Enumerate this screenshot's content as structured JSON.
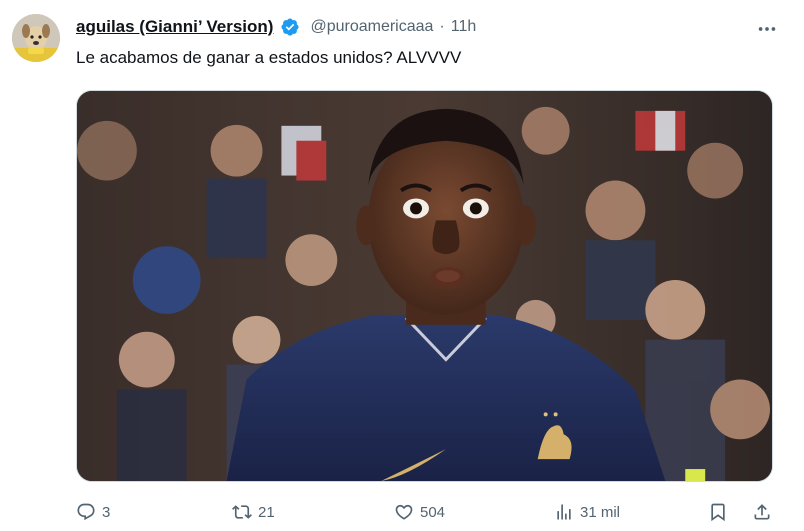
{
  "author": {
    "display_name": "aguilas (Gianni’ Version)",
    "handle": "@puroamericaaa",
    "separator": "·",
    "time_ago": "11h",
    "verified_color": "#1d9bf0"
  },
  "tweet": {
    "text": "Le acabamos de ganar a estados unidos? ALVVVV"
  },
  "actions": {
    "replies": "3",
    "reposts": "21",
    "likes": "504",
    "views": "31 mil"
  },
  "icons": {
    "avatar": "dog-avatar",
    "verified": "verified-badge-icon",
    "more": "more-dots-icon",
    "reply": "reply-icon",
    "repost": "repost-icon",
    "like": "heart-icon",
    "views": "views-chart-icon",
    "bookmark": "bookmark-icon",
    "share": "share-icon"
  },
  "colors": {
    "text_primary": "#0f1419",
    "text_secondary": "#536471",
    "border": "#cfd9de",
    "accent": "#1d9bf0"
  }
}
